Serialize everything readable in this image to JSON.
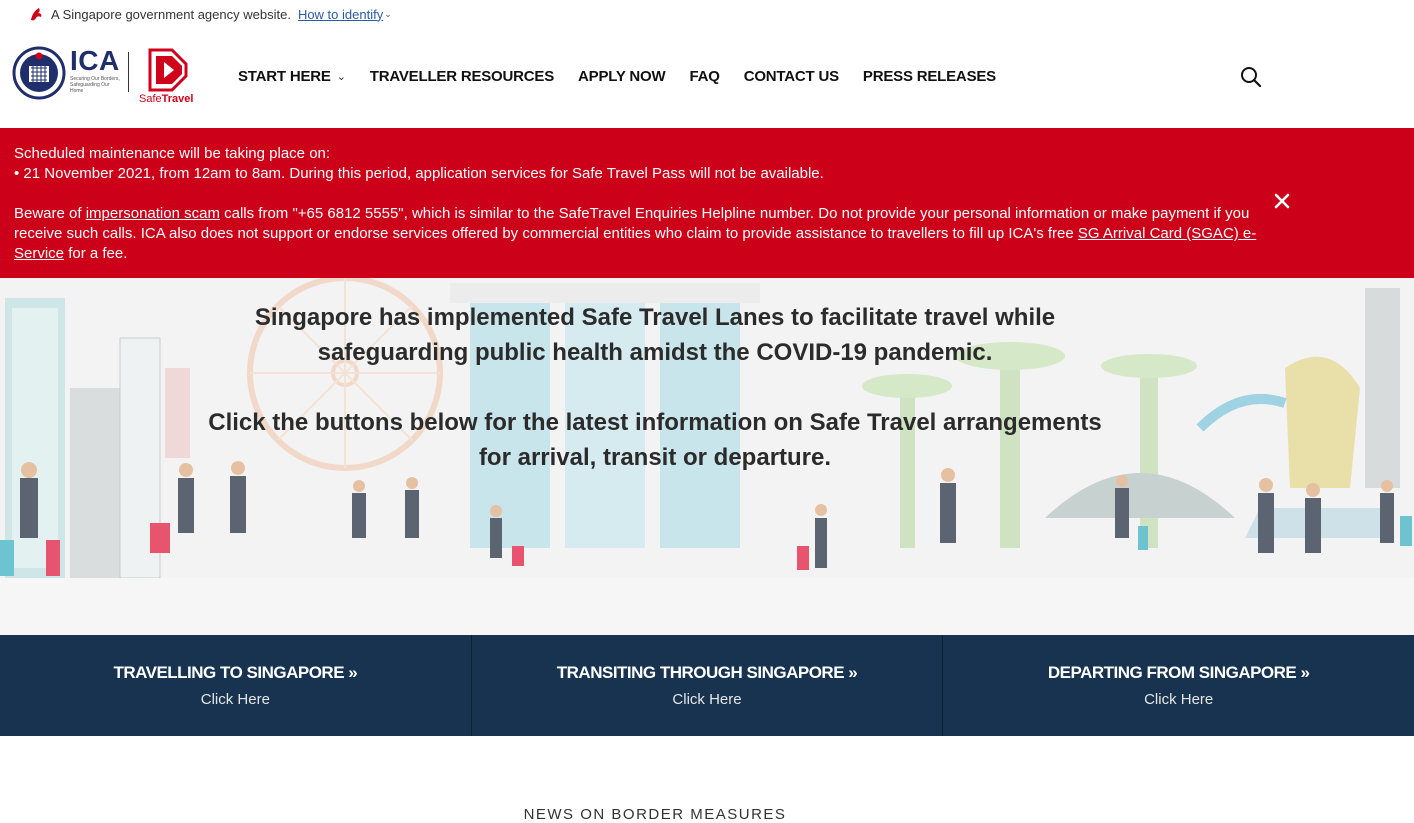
{
  "govbar": {
    "text": "A Singapore government agency website.",
    "link": "How to identify"
  },
  "header": {
    "ica_logo_text": "ICA",
    "ica_tagline": "Securing Our Borders, Safeguarding Our Home",
    "safetravel_word_a": "Safe",
    "safetravel_word_b": "Travel",
    "nav": [
      {
        "label": "START HERE"
      },
      {
        "label": "TRAVELLER RESOURCES"
      },
      {
        "label": "APPLY NOW"
      },
      {
        "label": "FAQ"
      },
      {
        "label": "CONTACT US"
      },
      {
        "label": "PRESS RELEASES"
      }
    ]
  },
  "alert": {
    "line1": "Scheduled maintenance will be taking place on:",
    "line2": "• 21 November 2021, from 12am to 8am. During this period, application services for Safe Travel Pass will not be available.",
    "p2_a": "Beware of ",
    "p2_link1": "impersonation scam",
    "p2_b": " calls from \"+65 6812 5555\", which is similar to the SafeTravel Enquiries Helpline number. Do not provide your personal information or make payment if you receive such calls. ICA also does not support or endorse services offered by commercial entities who claim to provide assistance to travellers to fill up ICA's free ",
    "p2_link2": "SG Arrival Card (SGAC) e-Service",
    "p2_c": " for a fee."
  },
  "hero": {
    "line1": "Singapore has implemented Safe Travel Lanes to facilitate travel while",
    "line2": "safeguarding public health amidst the COVID-19 pandemic.",
    "line3": "Click the buttons below for the latest information on Safe Travel arrangements",
    "line4": "for arrival, transit or departure."
  },
  "band": [
    {
      "title": "TRAVELLING TO SINGAPORE »",
      "sub": "Click Here"
    },
    {
      "title": "TRANSITING THROUGH SINGAPORE »",
      "sub": "Click Here"
    },
    {
      "title": "DEPARTING FROM SINGAPORE »",
      "sub": "Click Here"
    }
  ],
  "news_heading": "NEWS ON BORDER MEASURES",
  "colors": {
    "alert_bg": "#cc0018",
    "band_bg": "#17334f",
    "brand_red": "#d0021b",
    "ica_navy": "#1f2f6b",
    "link_blue": "#2b5aa8"
  }
}
